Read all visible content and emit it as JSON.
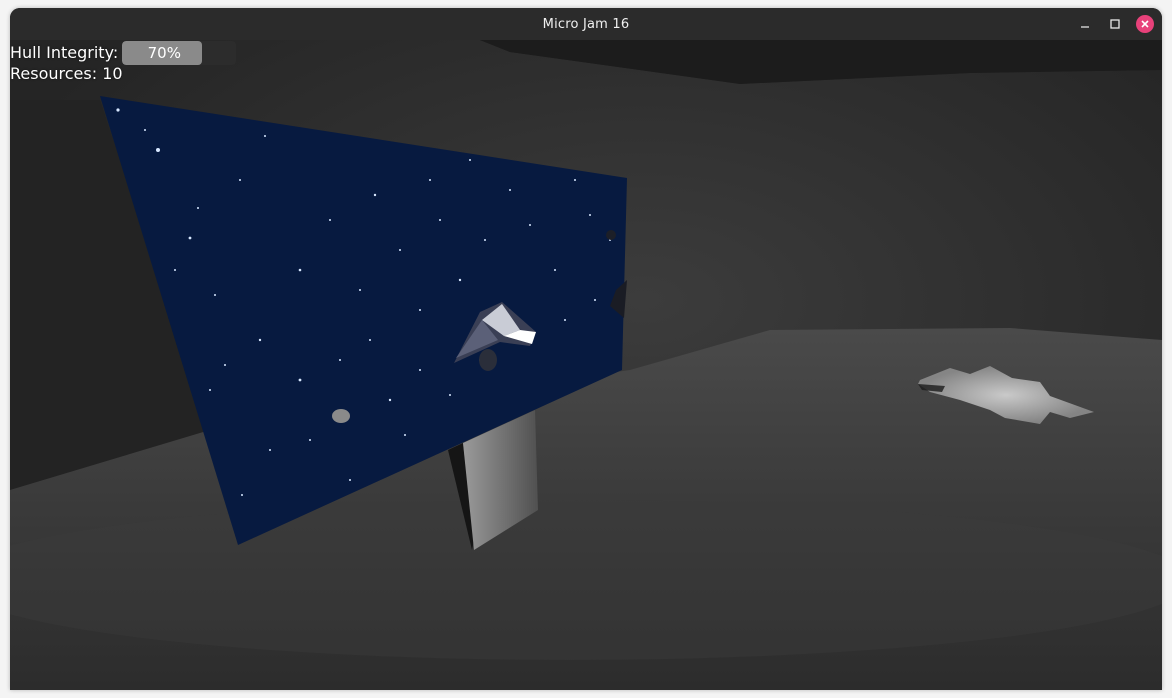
{
  "window": {
    "title": "Micro Jam 16",
    "minimize_icon": "minimize-icon",
    "maximize_icon": "maximize-icon",
    "close_icon": "close-icon"
  },
  "hud": {
    "hull_label": "Hull Integrity:",
    "hull_value": 0.7,
    "hull_text": "70%",
    "resources_label": "Resources: 10"
  },
  "colors": {
    "close_accent": "#e8417a",
    "space_bg": "#071a40",
    "hull_fill": "#8a8a8a"
  }
}
